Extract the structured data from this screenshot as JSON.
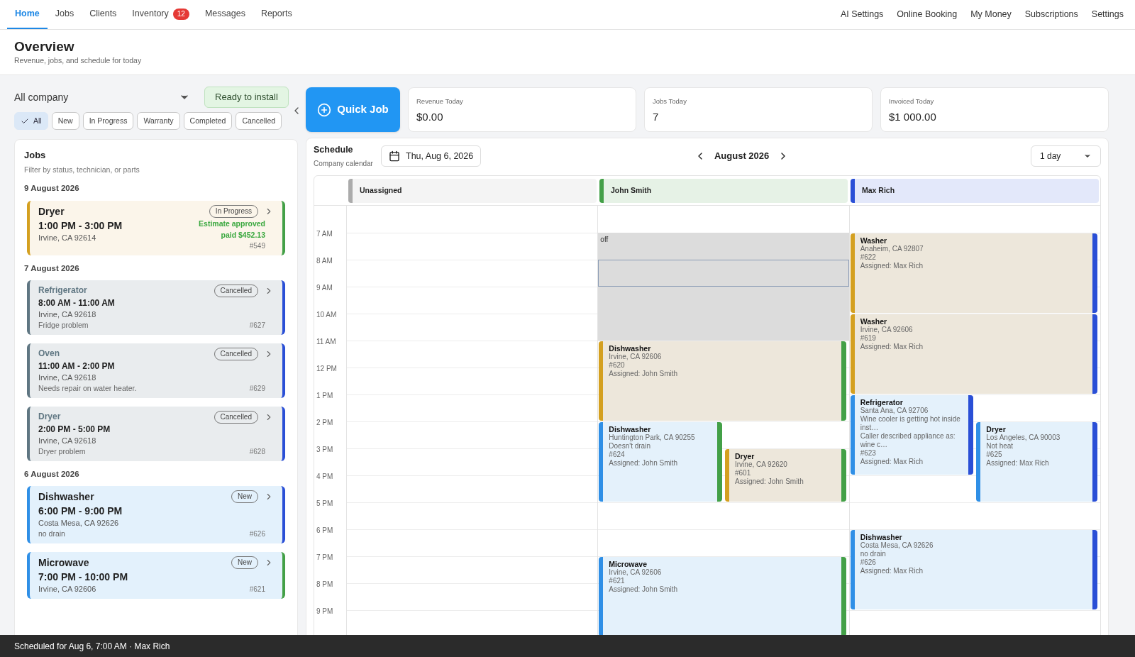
{
  "nav": {
    "tabs": [
      {
        "label": "Home",
        "selected": true
      },
      {
        "label": "Jobs",
        "selected": false
      },
      {
        "label": "Clients",
        "selected": false
      },
      {
        "label": "Inventory",
        "selected": false,
        "badge": "12"
      },
      {
        "label": "Messages",
        "selected": false
      },
      {
        "label": "Reports",
        "selected": false
      }
    ],
    "links": [
      "AI Settings",
      "Online Booking",
      "My Money",
      "Subscriptions",
      "Settings"
    ]
  },
  "header": {
    "title": "Overview",
    "subtitle": "Revenue, jobs, and schedule for today"
  },
  "company_select": {
    "value": "All company"
  },
  "ready_button": "Ready to install",
  "filters": [
    {
      "label": "All",
      "selected": true
    },
    {
      "label": "New",
      "selected": false
    },
    {
      "label": "In Progress",
      "selected": false
    },
    {
      "label": "Warranty",
      "selected": false
    },
    {
      "label": "Completed",
      "selected": false
    },
    {
      "label": "Cancelled",
      "selected": false
    }
  ],
  "jobs_panel": {
    "title": "Jobs",
    "subtitle": "Filter by status, technician, or parts",
    "groups": [
      {
        "date": "9 August 2026",
        "jobs": [
          {
            "kind": "progress",
            "title": "Dryer",
            "time": "1:00 PM - 3:00 PM",
            "address": "Irvine, CA 92614",
            "badge": "In Progress",
            "notes": [
              "Estimate approved",
              "paid $452.13"
            ],
            "number": "#549",
            "color": "#43a047"
          }
        ]
      },
      {
        "date": "7 August 2026",
        "jobs": [
          {
            "kind": "cancelled",
            "title": "Refrigerator",
            "time": "8:00 AM - 11:00 AM",
            "address": "Irvine, CA 92618",
            "description": "Fridge problem",
            "badge": "Cancelled",
            "number": "#627",
            "color": "#2a4fd6"
          },
          {
            "kind": "cancelled",
            "title": "Oven",
            "time": "11:00 AM - 2:00 PM",
            "address": "Irvine, CA 92618",
            "description": "Needs repair on water heater.",
            "badge": "Cancelled",
            "number": "#629",
            "color": "#2a4fd6"
          },
          {
            "kind": "cancelled",
            "title": "Dryer",
            "time": "2:00 PM - 5:00 PM",
            "address": "Irvine, CA 92618",
            "description": "Dryer problem",
            "badge": "Cancelled",
            "number": "#628",
            "color": "#2a4fd6"
          }
        ]
      },
      {
        "date": "6 August 2026",
        "jobs": [
          {
            "kind": "new",
            "title": "Dishwasher",
            "time": "6:00 PM - 9:00 PM",
            "address": "Costa Mesa, CA 92626",
            "description": "no drain",
            "badge": "New",
            "number": "#626",
            "color": "#2a4fd6"
          },
          {
            "kind": "new",
            "title": "Microwave",
            "time": "7:00 PM - 10:00 PM",
            "address": "Irvine, CA 92606",
            "badge": "New",
            "number": "#621",
            "color": "#43a047"
          }
        ]
      }
    ]
  },
  "quick_job": "Quick Job",
  "stats": [
    {
      "label": "Revenue Today",
      "value": "$0.00"
    },
    {
      "label": "Jobs Today",
      "value": "7"
    },
    {
      "label": "Invoiced Today",
      "value": "$1 000.00"
    }
  ],
  "schedule": {
    "title": "Schedule",
    "subtitle": "Company calendar",
    "date": "Thu, Aug 6, 2026",
    "month": "August 2026",
    "range": "1 day",
    "hours": [
      "7 AM",
      "8 AM",
      "9 AM",
      "10 AM",
      "11 AM",
      "12 PM",
      "1 PM",
      "2 PM",
      "3 PM",
      "4 PM",
      "5 PM",
      "6 PM",
      "7 PM",
      "8 PM",
      "9 PM"
    ],
    "columns": [
      {
        "name": "Unassigned",
        "color": "#ababab"
      },
      {
        "name": "John Smith",
        "color": "#43a047",
        "blocks": [
          {
            "label": "off",
            "kind": "full-7-11"
          }
        ],
        "selection": {
          "kind": "full-8-9"
        },
        "events": [
          {
            "kind": "full-11-14",
            "color": "#d4a020",
            "title": "Dishwasher",
            "lines": [
              "Irvine, CA 92606",
              "#620",
              "Assigned: John Smith"
            ]
          },
          {
            "kind": "left-14-17",
            "color": "#2f8fe6",
            "title": "Dishwasher",
            "lines": [
              "Huntington Park, CA 90255",
              "Doesn't drain",
              "#624",
              "Assigned: John Smith"
            ]
          },
          {
            "kind": "right-15-17",
            "color": "#d4a020",
            "title": "Dryer",
            "lines": [
              "Irvine, CA 92620",
              "#601",
              "Assigned: John Smith"
            ]
          },
          {
            "kind": "full-19-22",
            "color": "#2f8fe6",
            "title": "Microwave",
            "lines": [
              "Irvine, CA 92606",
              "#621",
              "Assigned: John Smith"
            ]
          }
        ]
      },
      {
        "name": "Max Rich",
        "color": "#2a4fd6",
        "events": [
          {
            "kind": "full-7-10",
            "color": "#d4a020",
            "title": "Washer",
            "lines": [
              "Anaheim, CA 92807",
              "#622",
              "Assigned: Max Rich"
            ]
          },
          {
            "kind": "full-10-13",
            "color": "#d4a020",
            "title": "Washer",
            "lines": [
              "Irvine, CA 92606",
              "#619",
              "Assigned: Max Rich"
            ]
          },
          {
            "kind": "left-13-16",
            "color": "#2f8fe6",
            "title": "Refrigerator",
            "lines": [
              "Santa Ana, CA 92706",
              "Wine cooler is getting hot inside inst…",
              "Caller described appliance as: wine c…",
              "#623",
              "Assigned: Max Rich"
            ]
          },
          {
            "kind": "right-14-17",
            "color": "#2f8fe6",
            "title": "Dryer",
            "lines": [
              "Los Angeles, CA 90003",
              "Not heat",
              "#625",
              "Assigned: Max Rich"
            ]
          },
          {
            "kind": "full-18-21",
            "color": "#2f8fe6",
            "title": "Dishwasher",
            "lines": [
              "Costa Mesa, CA 92626",
              "no drain",
              "#626",
              "Assigned: Max Rich"
            ]
          }
        ]
      }
    ]
  },
  "snackbar": "Scheduled for Aug 6, 7:00 AM · Max Rich"
}
